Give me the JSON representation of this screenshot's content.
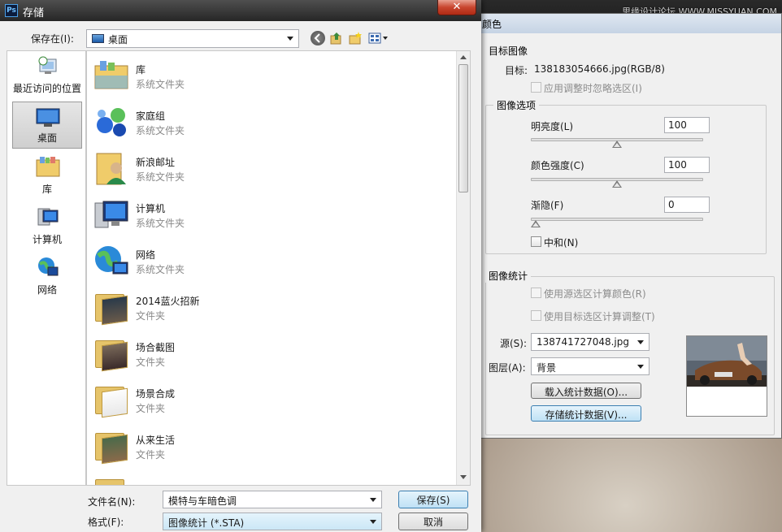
{
  "watermark": "思缘设计论坛 WWW.MISSYUAN.COM",
  "match_dialog": {
    "title": "颜色",
    "target_section": {
      "heading": "目标图像",
      "target_label": "目标:",
      "target_value": "138183054666.jpg(RGB/8)",
      "ignore_selection": "应用调整时忽略选区(I)"
    },
    "image_options": {
      "heading": "图像选项",
      "luminance_label": "明亮度(L)",
      "luminance_value": "100",
      "luminance_level": 0.5,
      "intensity_label": "颜色强度(C)",
      "intensity_value": "100",
      "intensity_level": 0.5,
      "fade_label": "渐隐(F)",
      "fade_value": "0",
      "fade_level": 0,
      "neutralize_label": "中和(N)"
    },
    "stats": {
      "heading": "图像统计",
      "use_source_sel": "使用源选区计算颜色(R)",
      "use_target_sel": "使用目标选区计算调整(T)",
      "source_label": "源(S):",
      "source_value": "138741727048.jpg",
      "layer_label": "图层(A):",
      "layer_value": "背景",
      "load_stats": "载入统计数据(O)...",
      "save_stats": "存储统计数据(V)..."
    }
  },
  "save_dialog": {
    "title": "存储",
    "save_in_label": "保存在(I):",
    "save_in_value": "桌面",
    "places": [
      {
        "label": "最近访问的位置",
        "icon": "recent-places-icon"
      },
      {
        "label": "桌面",
        "icon": "desktop-icon"
      },
      {
        "label": "库",
        "icon": "libraries-icon"
      },
      {
        "label": "计算机",
        "icon": "computer-icon"
      },
      {
        "label": "网络",
        "icon": "network-icon"
      }
    ],
    "files": [
      {
        "name": "库",
        "type": "系统文件夹",
        "icon": "libraries-icon"
      },
      {
        "name": "家庭组",
        "type": "系统文件夹",
        "icon": "homegroup-icon"
      },
      {
        "name": "新浪邮址",
        "type": "系统文件夹",
        "icon": "user-folder-icon"
      },
      {
        "name": "计算机",
        "type": "系统文件夹",
        "icon": "computer-icon"
      },
      {
        "name": "网络",
        "type": "系统文件夹",
        "icon": "network-icon"
      },
      {
        "name": "2014蓝火招新",
        "type": "文件夹",
        "icon": "folder-icon"
      },
      {
        "name": "场合截图",
        "type": "文件夹",
        "icon": "folder-icon"
      },
      {
        "name": "场景合成",
        "type": "文件夹",
        "icon": "folder-icon"
      },
      {
        "name": "从来生活",
        "type": "文件夹",
        "icon": "folder-icon"
      }
    ],
    "filename_label": "文件名(N):",
    "filename_value": "模特与车暗色调",
    "format_label": "格式(F):",
    "format_value": "图像统计 (*.STA)",
    "save_button": "保存(S)",
    "cancel_button": "取消"
  }
}
